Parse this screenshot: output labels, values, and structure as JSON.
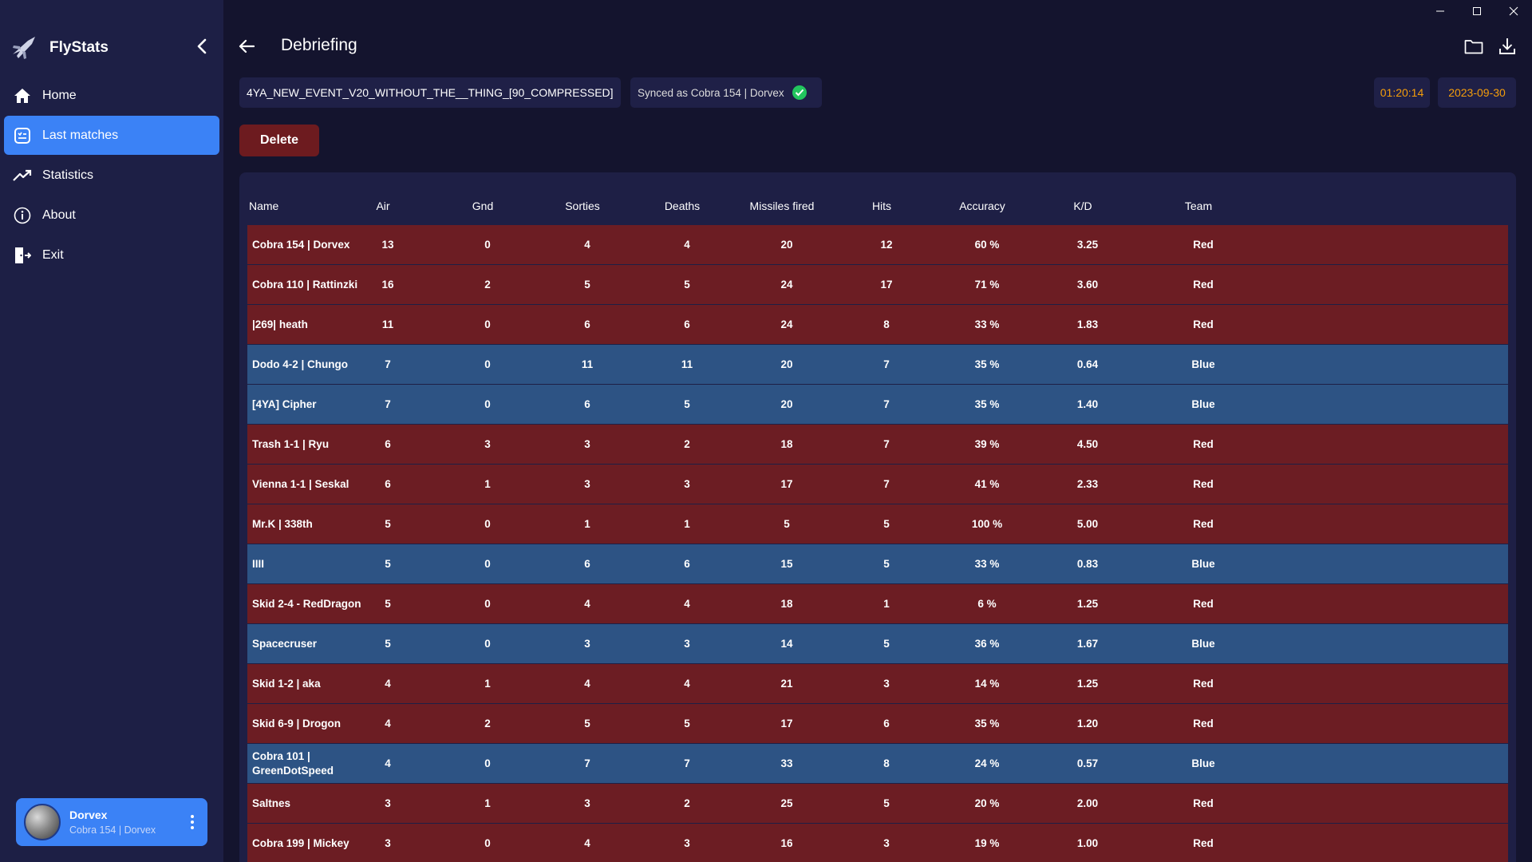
{
  "app": {
    "name": "FlyStats"
  },
  "sidebar": {
    "items": [
      {
        "label": "Home",
        "icon": "home-icon",
        "active": false
      },
      {
        "label": "Last matches",
        "icon": "list-icon",
        "active": true
      },
      {
        "label": "Statistics",
        "icon": "trending-up-icon",
        "active": false
      },
      {
        "label": "About",
        "icon": "info-icon",
        "active": false
      },
      {
        "label": "Exit",
        "icon": "exit-icon",
        "active": false
      }
    ],
    "user": {
      "name": "Dorvex",
      "callsign": "Cobra 154 | Dorvex"
    }
  },
  "header": {
    "title": "Debriefing"
  },
  "match": {
    "filename": "4YA_NEW_EVENT_V20_WITHOUT_THE__THING_[90_COMPRESSED]",
    "synced_label": "Synced as Cobra 154 | Dorvex",
    "duration": "01:20:14",
    "date": "2023-09-30",
    "delete_label": "Delete"
  },
  "colors": {
    "red_team": "#6c1d23",
    "blue_team": "#2d5384",
    "accent": "#3b82f6",
    "highlight": "#f59e0b"
  },
  "table": {
    "columns": [
      "Name",
      "Air",
      "Gnd",
      "Sorties",
      "Deaths",
      "Missiles fired",
      "Hits",
      "Accuracy",
      "K/D",
      "Team"
    ],
    "rows": [
      {
        "name": "Cobra 154 | Dorvex",
        "air": "13",
        "gnd": "0",
        "sorties": "4",
        "deaths": "4",
        "missiles": "20",
        "hits": "12",
        "accuracy": "60 %",
        "kd": "3.25",
        "team": "Red"
      },
      {
        "name": "Cobra 110 | Rattinzki",
        "air": "16",
        "gnd": "2",
        "sorties": "5",
        "deaths": "5",
        "missiles": "24",
        "hits": "17",
        "accuracy": "71 %",
        "kd": "3.60",
        "team": "Red"
      },
      {
        "name": "|269| heath",
        "air": "11",
        "gnd": "0",
        "sorties": "6",
        "deaths": "6",
        "missiles": "24",
        "hits": "8",
        "accuracy": "33 %",
        "kd": "1.83",
        "team": "Red"
      },
      {
        "name": "Dodo 4-2 | Chungo",
        "air": "7",
        "gnd": "0",
        "sorties": "11",
        "deaths": "11",
        "missiles": "20",
        "hits": "7",
        "accuracy": "35 %",
        "kd": "0.64",
        "team": "Blue"
      },
      {
        "name": "[4YA] Cipher",
        "air": "7",
        "gnd": "0",
        "sorties": "6",
        "deaths": "5",
        "missiles": "20",
        "hits": "7",
        "accuracy": "35 %",
        "kd": "1.40",
        "team": "Blue"
      },
      {
        "name": "Trash 1-1 | Ryu",
        "air": "6",
        "gnd": "3",
        "sorties": "3",
        "deaths": "2",
        "missiles": "18",
        "hits": "7",
        "accuracy": "39 %",
        "kd": "4.50",
        "team": "Red"
      },
      {
        "name": "Vienna 1-1 | Seskal",
        "air": "6",
        "gnd": "1",
        "sorties": "3",
        "deaths": "3",
        "missiles": "17",
        "hits": "7",
        "accuracy": "41 %",
        "kd": "2.33",
        "team": "Red"
      },
      {
        "name": "Mr.K | 338th",
        "air": "5",
        "gnd": "0",
        "sorties": "1",
        "deaths": "1",
        "missiles": "5",
        "hits": "5",
        "accuracy": "100 %",
        "kd": "5.00",
        "team": "Red"
      },
      {
        "name": "IIII",
        "air": "5",
        "gnd": "0",
        "sorties": "6",
        "deaths": "6",
        "missiles": "15",
        "hits": "5",
        "accuracy": "33 %",
        "kd": "0.83",
        "team": "Blue"
      },
      {
        "name": "Skid 2-4 - RedDragon",
        "air": "5",
        "gnd": "0",
        "sorties": "4",
        "deaths": "4",
        "missiles": "18",
        "hits": "1",
        "accuracy": "6 %",
        "kd": "1.25",
        "team": "Red"
      },
      {
        "name": "Spacecruser",
        "air": "5",
        "gnd": "0",
        "sorties": "3",
        "deaths": "3",
        "missiles": "14",
        "hits": "5",
        "accuracy": "36 %",
        "kd": "1.67",
        "team": "Blue"
      },
      {
        "name": "Skid 1-2 | aka",
        "air": "4",
        "gnd": "1",
        "sorties": "4",
        "deaths": "4",
        "missiles": "21",
        "hits": "3",
        "accuracy": "14 %",
        "kd": "1.25",
        "team": "Red"
      },
      {
        "name": "Skid 6-9 | Drogon",
        "air": "4",
        "gnd": "2",
        "sorties": "5",
        "deaths": "5",
        "missiles": "17",
        "hits": "6",
        "accuracy": "35 %",
        "kd": "1.20",
        "team": "Red"
      },
      {
        "name": "Cobra 101 | GreenDotSpeed",
        "air": "4",
        "gnd": "0",
        "sorties": "7",
        "deaths": "7",
        "missiles": "33",
        "hits": "8",
        "accuracy": "24 %",
        "kd": "0.57",
        "team": "Blue"
      },
      {
        "name": "Saltnes",
        "air": "3",
        "gnd": "1",
        "sorties": "3",
        "deaths": "2",
        "missiles": "25",
        "hits": "5",
        "accuracy": "20 %",
        "kd": "2.00",
        "team": "Red"
      },
      {
        "name": "Cobra 199 | Mickey",
        "air": "3",
        "gnd": "0",
        "sorties": "4",
        "deaths": "3",
        "missiles": "16",
        "hits": "3",
        "accuracy": "19 %",
        "kd": "1.00",
        "team": "Red"
      }
    ]
  }
}
